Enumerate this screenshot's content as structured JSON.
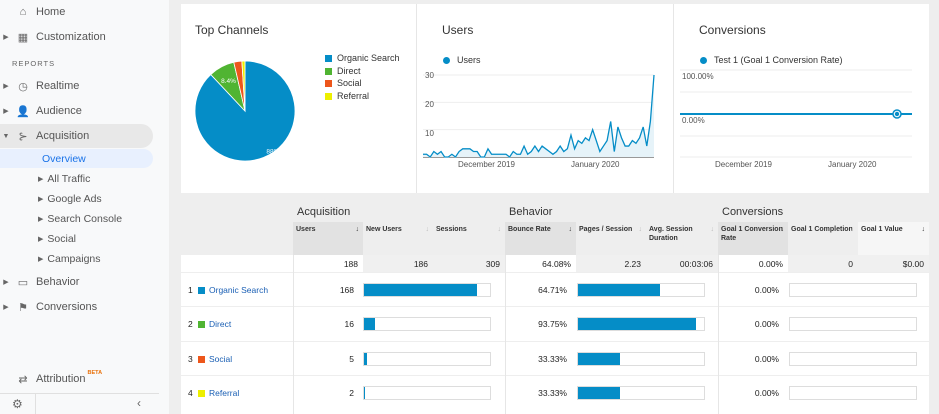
{
  "sidebar": {
    "items": [
      {
        "label": "Home",
        "icon": "home-icon"
      },
      {
        "label": "Customization",
        "icon": "dashboard-icon"
      }
    ],
    "section": "REPORTS",
    "reports": [
      {
        "label": "Realtime",
        "icon": "clock-icon"
      },
      {
        "label": "Audience",
        "icon": "person-icon"
      },
      {
        "label": "Acquisition",
        "icon": "acquisition-icon"
      }
    ],
    "acq_sub": [
      "Overview",
      "All Traffic",
      "Google Ads",
      "Search Console",
      "Social",
      "Campaigns"
    ],
    "reports2": [
      {
        "label": "Behavior",
        "icon": "window-icon"
      },
      {
        "label": "Conversions",
        "icon": "flag-icon"
      }
    ],
    "attribution": "Attribution",
    "beta": "BETA"
  },
  "colors": {
    "blue": "#058dc7",
    "green": "#50b432",
    "red": "#ed561b",
    "yellow": "#edef00",
    "link": "#1a5fb4"
  },
  "chart_data": [
    {
      "type": "pie",
      "title": "Top Channels",
      "categories": [
        "Organic Search",
        "Direct",
        "Social",
        "Referral"
      ],
      "values": [
        88,
        8.4,
        2.6,
        1.0
      ],
      "labels": [
        "88%",
        "8.4%",
        "",
        ""
      ],
      "colors": [
        "#058dc7",
        "#50b432",
        "#ed561b",
        "#edef00"
      ],
      "legend": "right"
    },
    {
      "type": "area",
      "title": "Users",
      "series": [
        {
          "name": "Users",
          "values": [
            1,
            1,
            0,
            2,
            1,
            2,
            0,
            0,
            1,
            0,
            2,
            3,
            3,
            3,
            2,
            2,
            0,
            0,
            3,
            1,
            1,
            1,
            1,
            1,
            0,
            2,
            1,
            1,
            4,
            1,
            2,
            4,
            2,
            4,
            3,
            2,
            1,
            2,
            4,
            2,
            3,
            8,
            3,
            6,
            5,
            7,
            6,
            10,
            6,
            2,
            4,
            6,
            13,
            2,
            11,
            7,
            4,
            4,
            6,
            5,
            7,
            11,
            4,
            13,
            30
          ]
        }
      ],
      "yticks": [
        "10",
        "20",
        "30"
      ],
      "ylim": [
        0,
        30
      ],
      "xticks": [
        "December 2019",
        "January 2020"
      ],
      "grid": true,
      "legend": "top-left"
    },
    {
      "type": "line",
      "title": "Conversions",
      "series": [
        {
          "name": "Test 1 (Goal 1 Conversion Rate)",
          "values": [
            0
          ]
        }
      ],
      "yticks": [
        "100.00%",
        "0.00%"
      ],
      "xticks": [
        "December 2019",
        "January 2020"
      ],
      "grid": true,
      "legend": "top-left"
    }
  ],
  "table": {
    "groups": [
      "Acquisition",
      "Behavior",
      "Conversions"
    ],
    "columns": [
      "Users",
      "New Users",
      "Sessions",
      "Bounce Rate",
      "Pages / Session",
      "Avg. Session Duration",
      "Goal 1 Conversion Rate",
      "Goal 1 Completion",
      "Goal 1 Value"
    ],
    "totals": [
      "188",
      "186",
      "309",
      "64.08%",
      "2.23",
      "00:03:06",
      "0.00%",
      "0",
      "$0.00"
    ],
    "rows": [
      {
        "n": "1",
        "channel": "Organic Search",
        "users": "168",
        "users_frac": 0.894,
        "bounce": "64.71%",
        "bounce_frac": 0.6471,
        "conv": "0.00%",
        "conv_frac": 0,
        "color": "#058dc7"
      },
      {
        "n": "2",
        "channel": "Direct",
        "users": "16",
        "users_frac": 0.085,
        "bounce": "93.75%",
        "bounce_frac": 0.9375,
        "conv": "0.00%",
        "conv_frac": 0,
        "color": "#50b432"
      },
      {
        "n": "3",
        "channel": "Social",
        "users": "5",
        "users_frac": 0.027,
        "bounce": "33.33%",
        "bounce_frac": 0.3333,
        "conv": "0.00%",
        "conv_frac": 0,
        "color": "#ed561b"
      },
      {
        "n": "4",
        "channel": "Referral",
        "users": "2",
        "users_frac": 0.011,
        "bounce": "33.33%",
        "bounce_frac": 0.3333,
        "conv": "0.00%",
        "conv_frac": 0,
        "color": "#edef00"
      }
    ]
  }
}
